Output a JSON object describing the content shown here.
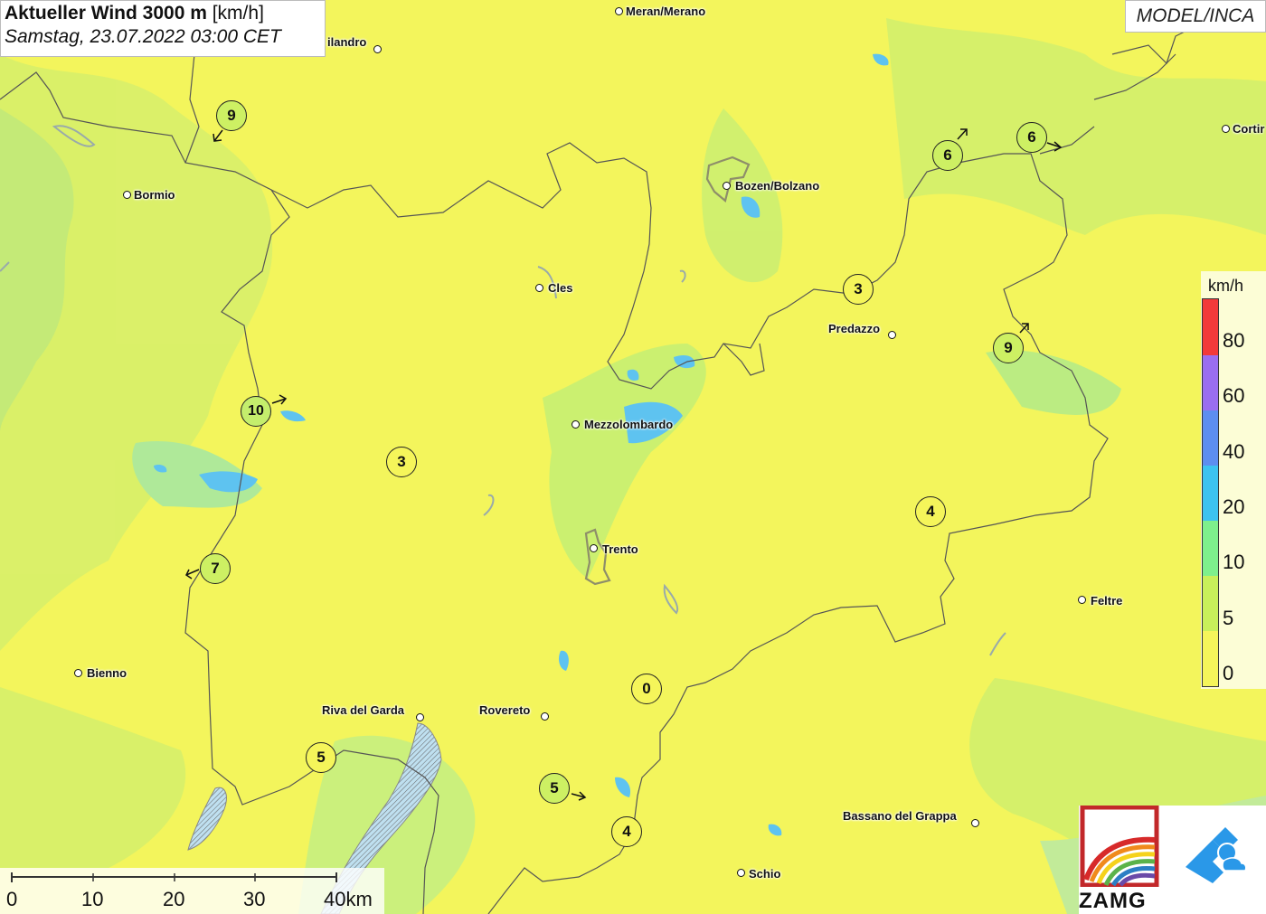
{
  "title": {
    "bold": "Aktueller Wind 3000 m",
    "unit": " [km/h]",
    "subtitle": "Samstag, 23.07.2022 03:00 CET"
  },
  "model_label": "MODEL/INCA",
  "cities": [
    {
      "name": "Meran/Merano"
    },
    {
      "name": "ilandro"
    },
    {
      "name": "Bormio"
    },
    {
      "name": "Bozen/Bolzano"
    },
    {
      "name": "Cortir"
    },
    {
      "name": "Cles"
    },
    {
      "name": "Predazzo"
    },
    {
      "name": "Mezzolombardo"
    },
    {
      "name": "Trento"
    },
    {
      "name": "Feltre"
    },
    {
      "name": "Bienno"
    },
    {
      "name": "Riva del Garda"
    },
    {
      "name": "Rovereto"
    },
    {
      "name": "Bassano del Grappa"
    },
    {
      "name": "Schio"
    }
  ],
  "wind_markers": [
    {
      "value": "9",
      "color": "#cdf063"
    },
    {
      "value": "6",
      "color": "#cdf063"
    },
    {
      "value": "6",
      "color": "#cdf063"
    },
    {
      "value": "3",
      "color": "#f5f55a"
    },
    {
      "value": "9",
      "color": "#cdf063"
    },
    {
      "value": "10",
      "color": "#c4ee6c"
    },
    {
      "value": "3",
      "color": "#f5f55a"
    },
    {
      "value": "4",
      "color": "#f5f55a"
    },
    {
      "value": "7",
      "color": "#cdf063"
    },
    {
      "value": "0",
      "color": "#f5f55a"
    },
    {
      "value": "5",
      "color": "#f5f55a"
    },
    {
      "value": "5",
      "color": "#cdf063"
    },
    {
      "value": "4",
      "color": "#f5f55a"
    }
  ],
  "legend": {
    "unit": "km/h",
    "labels": [
      "80",
      "60",
      "40",
      "20",
      "10",
      "5",
      "0"
    ],
    "colors": [
      "#f23a3a",
      "#9a6ef0",
      "#5d8ef0",
      "#3cc3f0",
      "#7ef08c",
      "#c8f05a",
      "#f5f55a"
    ]
  },
  "scalebar": {
    "labels": [
      "0",
      "10",
      "20",
      "30",
      "40km"
    ]
  },
  "logo": {
    "text": "ZAMG"
  }
}
